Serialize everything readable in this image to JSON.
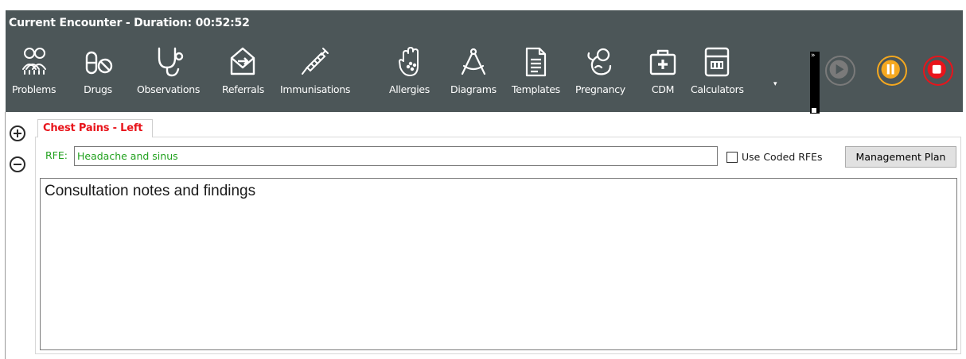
{
  "header": {
    "title": "Current Encounter - Duration: 00:52:52"
  },
  "toolbar": {
    "items": [
      {
        "label": "Problems",
        "icon": "problems-icon"
      },
      {
        "label": "Drugs",
        "icon": "drugs-icon"
      },
      {
        "label": "Observations",
        "icon": "stethoscope-icon"
      },
      {
        "label": "Referrals",
        "icon": "referral-envelope-icon"
      },
      {
        "label": "Immunisations",
        "icon": "syringe-icon"
      },
      {
        "label": "Allergies",
        "icon": "hand-icon"
      },
      {
        "label": "Diagrams",
        "icon": "compass-icon"
      },
      {
        "label": "Templates",
        "icon": "document-icon"
      },
      {
        "label": "Pregnancy",
        "icon": "fetus-icon"
      },
      {
        "label": "CDM",
        "icon": "medical-kit-icon"
      },
      {
        "label": "Calculators",
        "icon": "calculator-icon"
      }
    ],
    "overflow_glyph": "▾",
    "scroll_glyph": "»"
  },
  "controls": {
    "play_color": "#7a7a7a",
    "pause_color": "#f5a81f",
    "stop_color": "#e8141b"
  },
  "tab": {
    "label": "Chest Pains - Left",
    "color": "#e8141b"
  },
  "rfe": {
    "label": "RFE:",
    "value": "Headache and sinus"
  },
  "coded_rfes": {
    "label": "Use Coded RFEs",
    "checked": false
  },
  "management_plan": {
    "label": "Management Plan"
  },
  "notes": {
    "value": "Consultation notes and findings"
  },
  "colors": {
    "toolbar_bg": "#4c5658",
    "rfe_text": "#21a11e"
  }
}
